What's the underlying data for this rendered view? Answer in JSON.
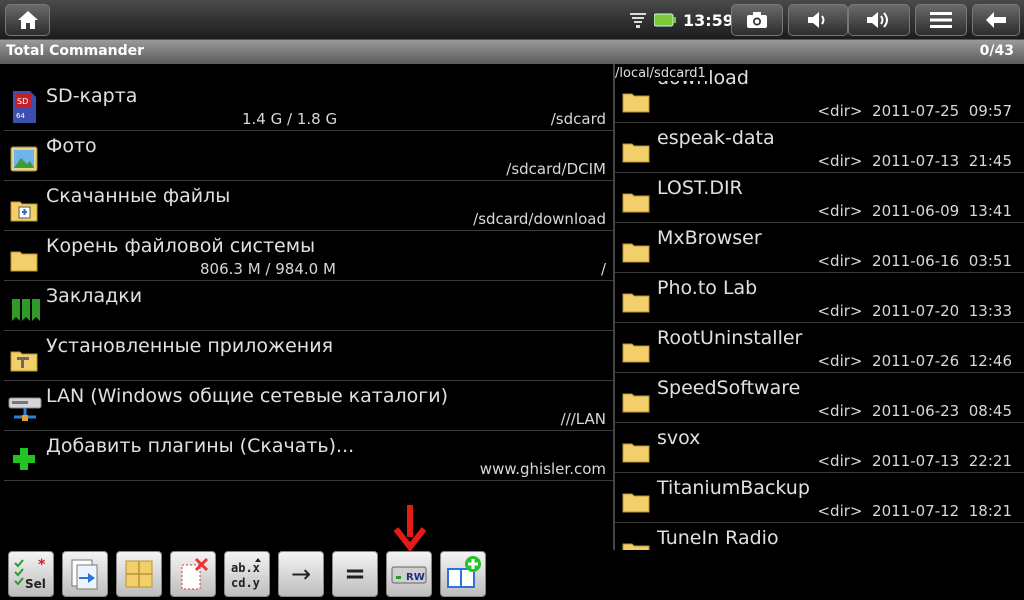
{
  "status_bar": {
    "time": "13:59"
  },
  "title_bar": {
    "title": "Total Commander",
    "counter": "0/43"
  },
  "left_panel": {
    "items": [
      {
        "name": "SD-карта",
        "size": "1.4 G / 1.8 G",
        "path": "/sdcard",
        "icon": "sd-card-icon"
      },
      {
        "name": "Фото",
        "size": "",
        "path": "/sdcard/DCIM",
        "icon": "photo-icon"
      },
      {
        "name": "Скачанные файлы",
        "size": "",
        "path": "/sdcard/download",
        "icon": "download-folder-icon"
      },
      {
        "name": "Корень файловой системы",
        "size": "806.3 M / 984.0 M",
        "path": "/",
        "icon": "root-folder-icon"
      },
      {
        "name": "Закладки",
        "size": "",
        "path": "",
        "icon": "bookmarks-icon"
      },
      {
        "name": "Установленные приложения",
        "size": "",
        "path": "",
        "icon": "apps-folder-icon"
      },
      {
        "name": "LAN (Windows общие сетевые каталоги)",
        "size": "",
        "path": "///LAN",
        "icon": "lan-icon"
      },
      {
        "name": "Добавить плагины (Скачать)...",
        "size": "",
        "path": "www.ghisler.com",
        "icon": "add-plugin-icon"
      }
    ]
  },
  "right_panel": {
    "path": "/local/sdcard1",
    "items": [
      {
        "name": "download",
        "type": "<dir>",
        "date": "2011-07-25",
        "time": "09:57"
      },
      {
        "name": "espeak-data",
        "type": "<dir>",
        "date": "2011-07-13",
        "time": "21:45"
      },
      {
        "name": "LOST.DIR",
        "type": "<dir>",
        "date": "2011-06-09",
        "time": "13:41"
      },
      {
        "name": "MxBrowser",
        "type": "<dir>",
        "date": "2011-06-16",
        "time": "03:51"
      },
      {
        "name": "Pho.to Lab",
        "type": "<dir>",
        "date": "2011-07-20",
        "time": "13:33"
      },
      {
        "name": "RootUninstaller",
        "type": "<dir>",
        "date": "2011-07-26",
        "time": "12:46"
      },
      {
        "name": "SpeedSoftware",
        "type": "<dir>",
        "date": "2011-06-23",
        "time": "08:45"
      },
      {
        "name": "svox",
        "type": "<dir>",
        "date": "2011-07-13",
        "time": "22:21"
      },
      {
        "name": "TitaniumBackup",
        "type": "<dir>",
        "date": "2011-07-12",
        "time": "18:21"
      },
      {
        "name": "TuneIn Radio",
        "type": "",
        "date": "",
        "time": ""
      }
    ]
  },
  "toolbar": {
    "sel_label": "Sel",
    "rename_label": "ab.x cd.y",
    "move_label": "→",
    "compare_label": "=",
    "rw_label": "RW"
  },
  "colors": {
    "folder": "#f2cf6a",
    "highlight_arrow": "#e41b17"
  }
}
